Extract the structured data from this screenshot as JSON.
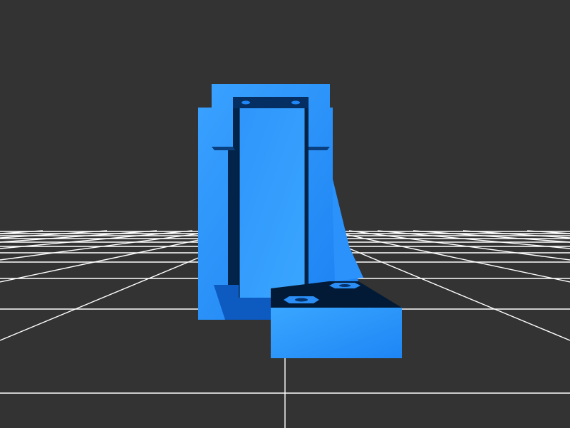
{
  "viewer": {
    "kind": "3d-model-viewer",
    "colors": {
      "background": "#333333",
      "grid": "#ffffff",
      "model_light": "#3aa2ff",
      "model_mid": "#1f86f5",
      "model_shade": "#0f5fc8",
      "model_dark": "#052a57",
      "model_darkest": "#02152c"
    },
    "grid": {
      "visible": true
    },
    "model": {
      "label": ""
    }
  }
}
